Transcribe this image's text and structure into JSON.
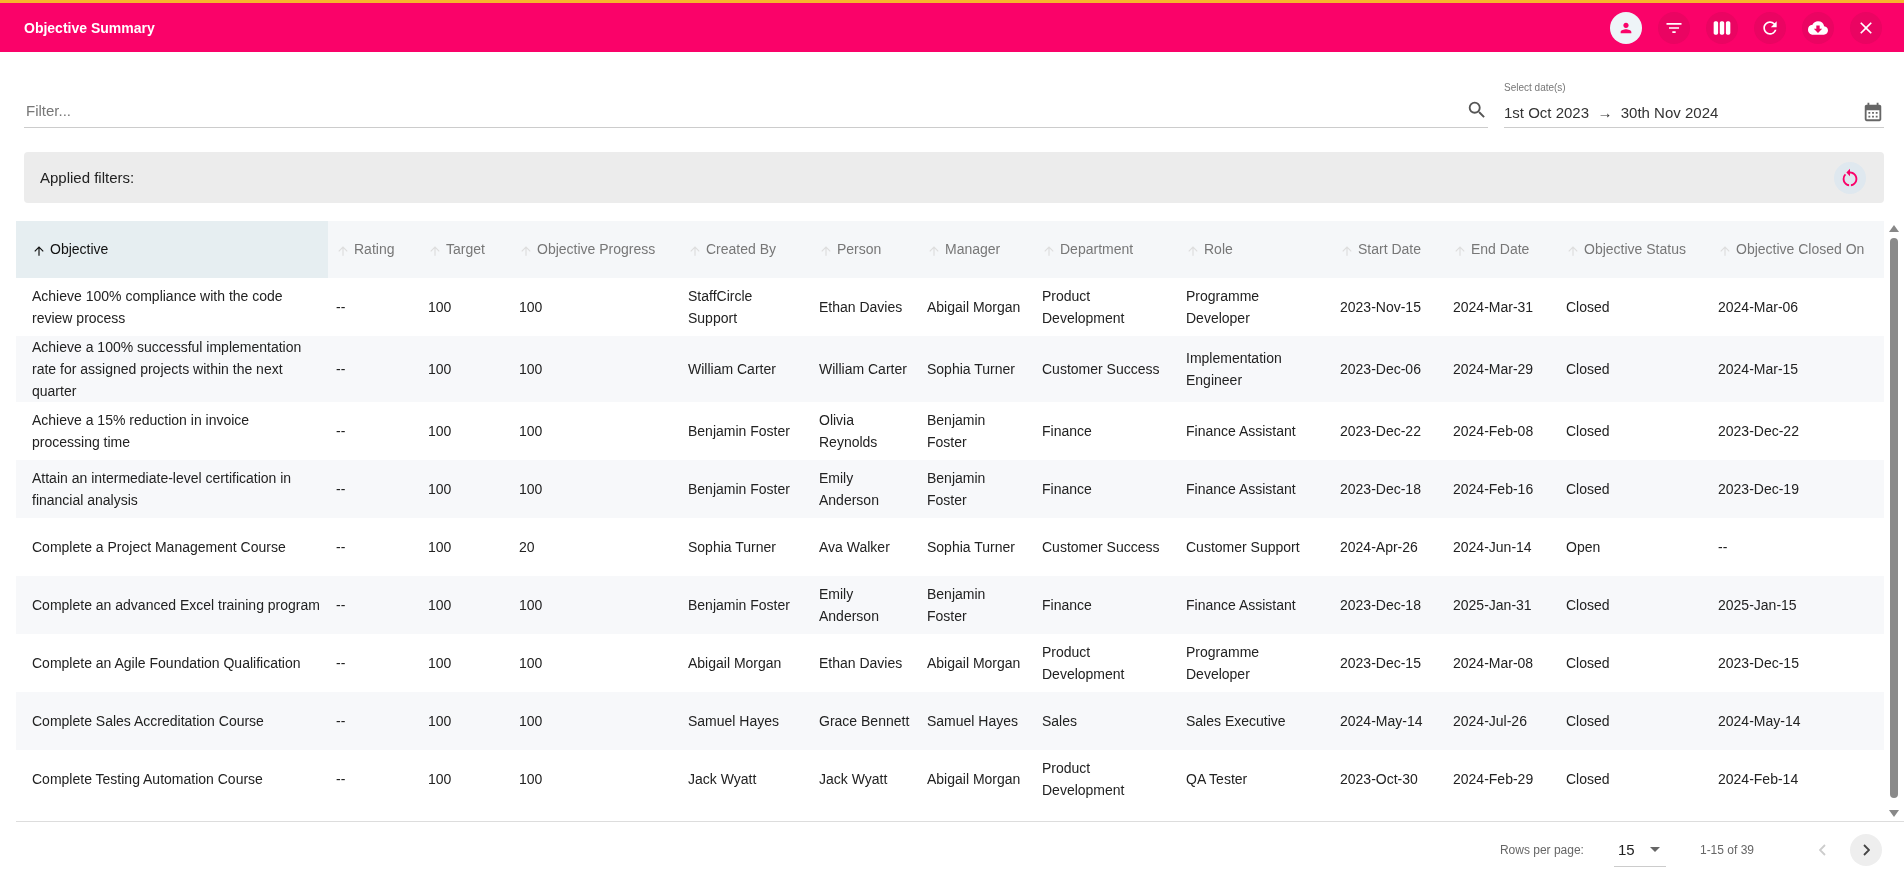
{
  "window": {
    "title": "Objective Summary"
  },
  "filter": {
    "placeholder": "Filter..."
  },
  "date_range": {
    "label": "Select date(s)",
    "start": "1st Oct 2023",
    "arrow": "→",
    "end": "30th Nov 2024"
  },
  "applied_filters": {
    "label": "Applied filters:"
  },
  "table": {
    "columns": [
      {
        "label": "Objective",
        "sorted": true
      },
      {
        "label": "Rating",
        "sorted": false
      },
      {
        "label": "Target",
        "sorted": false
      },
      {
        "label": "Objective Progress",
        "sorted": false
      },
      {
        "label": "Created By",
        "sorted": false
      },
      {
        "label": "Person",
        "sorted": false
      },
      {
        "label": "Manager",
        "sorted": false
      },
      {
        "label": "Department",
        "sorted": false
      },
      {
        "label": "Role",
        "sorted": false
      },
      {
        "label": "Start Date",
        "sorted": false
      },
      {
        "label": "End Date",
        "sorted": false
      },
      {
        "label": "Objective Status",
        "sorted": false
      },
      {
        "label": "Objective Closed On",
        "sorted": false
      }
    ],
    "rows": [
      [
        "Achieve 100% compliance with the code review process",
        "--",
        "100",
        "100",
        "StaffCircle Support",
        "Ethan Davies",
        "Abigail Morgan",
        "Product Development",
        "Programme Developer",
        "2023-Nov-15",
        "2024-Mar-31",
        "Closed",
        "2024-Mar-06"
      ],
      [
        "Achieve a 100% successful implementation rate for assigned projects within the next quarter",
        "--",
        "100",
        "100",
        "William Carter",
        "William Carter",
        "Sophia Turner",
        "Customer Success",
        "Implementation Engineer",
        "2023-Dec-06",
        "2024-Mar-29",
        "Closed",
        "2024-Mar-15"
      ],
      [
        "Achieve a 15% reduction in invoice processing time",
        "--",
        "100",
        "100",
        "Benjamin Foster",
        "Olivia Reynolds",
        "Benjamin Foster",
        "Finance",
        "Finance Assistant",
        "2023-Dec-22",
        "2024-Feb-08",
        "Closed",
        "2023-Dec-22"
      ],
      [
        "Attain an intermediate-level certification in financial analysis",
        "--",
        "100",
        "100",
        "Benjamin Foster",
        "Emily Anderson",
        "Benjamin Foster",
        "Finance",
        "Finance Assistant",
        "2023-Dec-18",
        "2024-Feb-16",
        "Closed",
        "2023-Dec-19"
      ],
      [
        "Complete a Project Management Course",
        "--",
        "100",
        "20",
        "Sophia Turner",
        "Ava Walker",
        "Sophia Turner",
        "Customer Success",
        "Customer Support",
        "2024-Apr-26",
        "2024-Jun-14",
        "Open",
        "--"
      ],
      [
        "Complete an advanced Excel training program",
        "--",
        "100",
        "100",
        "Benjamin Foster",
        "Emily Anderson",
        "Benjamin Foster",
        "Finance",
        "Finance Assistant",
        "2023-Dec-18",
        "2025-Jan-31",
        "Closed",
        "2025-Jan-15"
      ],
      [
        "Complete an Agile Foundation Qualification",
        "--",
        "100",
        "100",
        "Abigail Morgan",
        "Ethan Davies",
        "Abigail Morgan",
        "Product Development",
        "Programme Developer",
        "2023-Dec-15",
        "2024-Mar-08",
        "Closed",
        "2023-Dec-15"
      ],
      [
        "Complete Sales Accreditation Course",
        "--",
        "100",
        "100",
        "Samuel Hayes",
        "Grace Bennett",
        "Samuel Hayes",
        "Sales",
        "Sales Executive",
        "2024-May-14",
        "2024-Jul-26",
        "Closed",
        "2024-May-14"
      ],
      [
        "Complete Testing Automation Course",
        "--",
        "100",
        "100",
        "Jack Wyatt",
        "Jack Wyatt",
        "Abigail Morgan",
        "Product Development",
        "QA Tester",
        "2023-Oct-30",
        "2024-Feb-29",
        "Closed",
        "2024-Feb-14"
      ]
    ]
  },
  "pagination": {
    "rows_per_page_label": "Rows per page:",
    "rows_per_page": "15",
    "range": "1-15 of 39",
    "previous_disabled": true,
    "next_disabled": false
  }
}
